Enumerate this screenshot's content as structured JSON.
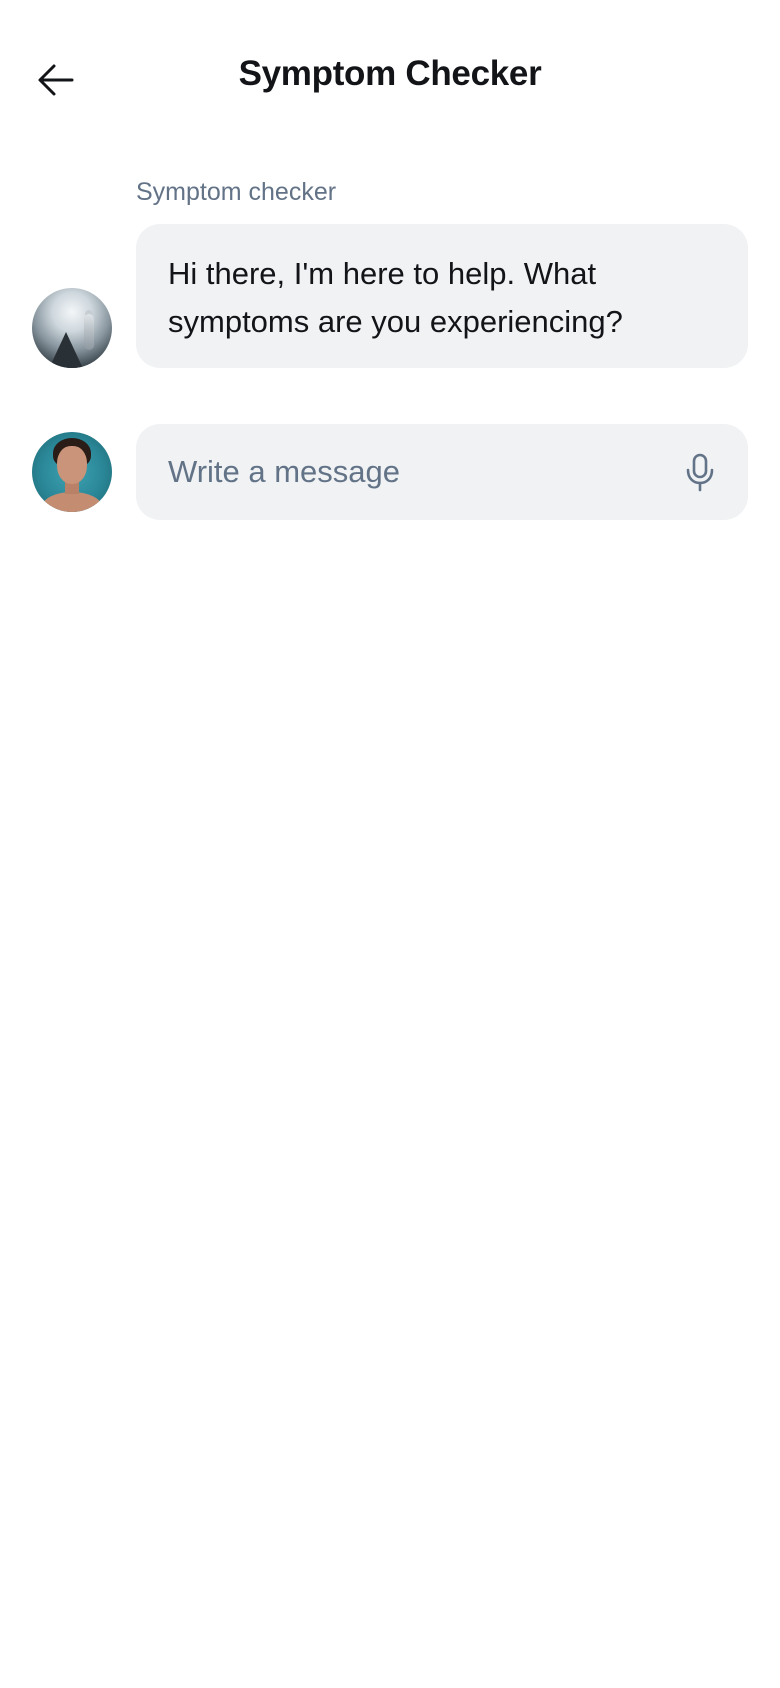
{
  "header": {
    "title": "Symptom Checker",
    "back_icon": "arrow-left-icon"
  },
  "conversation": {
    "sender_label": "Symptom checker",
    "messages": [
      {
        "from": "bot",
        "text": "Hi there, I'm here to help. What symptoms are you experiencing?"
      }
    ]
  },
  "composer": {
    "placeholder": "Write a message",
    "value": "",
    "mic_icon": "microphone-icon"
  },
  "colors": {
    "background": "#ffffff",
    "bubble": "#f0f2f4",
    "text_primary": "#121417",
    "text_secondary": "#637387"
  }
}
